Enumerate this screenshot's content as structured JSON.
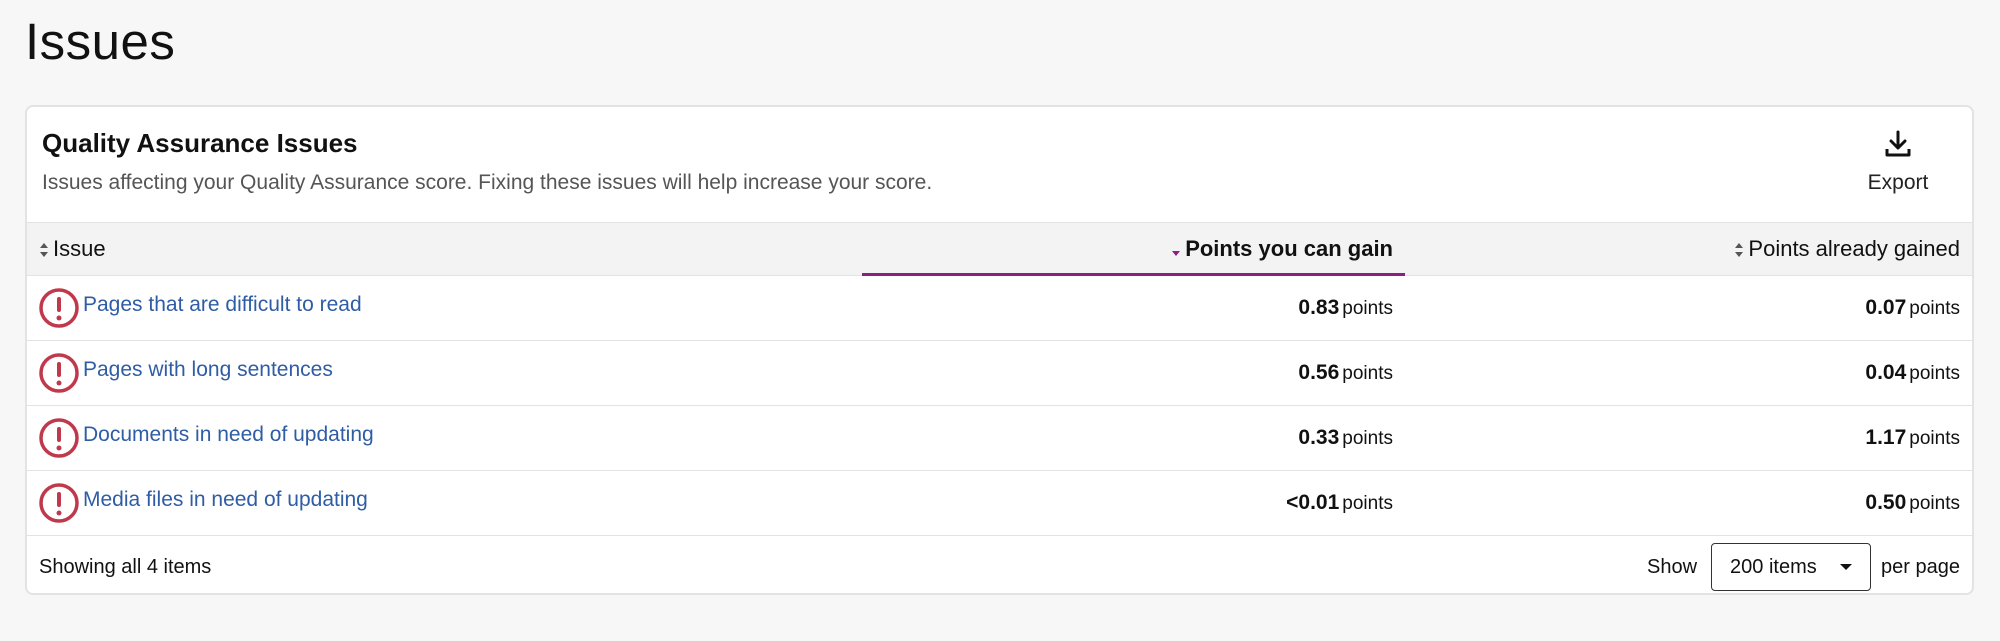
{
  "page": {
    "title": "Issues"
  },
  "card": {
    "title": "Quality Assurance Issues",
    "subtitle": "Issues affecting your Quality Assurance score. Fixing these issues will help increase your score.",
    "export_label": "Export"
  },
  "table": {
    "columns": {
      "issue": "Issue",
      "gain": "Points you can gain",
      "gained": "Points already gained"
    },
    "unit": "points",
    "rows": [
      {
        "issue": "Pages that are difficult to read",
        "gain": "0.83",
        "gained": "0.07"
      },
      {
        "issue": "Pages with long sentences",
        "gain": "0.56",
        "gained": "0.04"
      },
      {
        "issue": "Documents in need of updating",
        "gain": "0.33",
        "gained": "1.17"
      },
      {
        "issue": "Media files in need of updating",
        "gain": "<0.01",
        "gained": "0.50"
      }
    ]
  },
  "footer": {
    "count": "Showing all 4 items",
    "show_label": "Show",
    "page_size": "200 items",
    "per_page_label": "per page"
  },
  "colors": {
    "accent": "#8d1e84",
    "link": "#2f5da5",
    "warning": "#c0394b"
  },
  "icons": {
    "export": "download-icon",
    "sort": "sort-icon",
    "warning": "exclamation-circle-icon"
  }
}
